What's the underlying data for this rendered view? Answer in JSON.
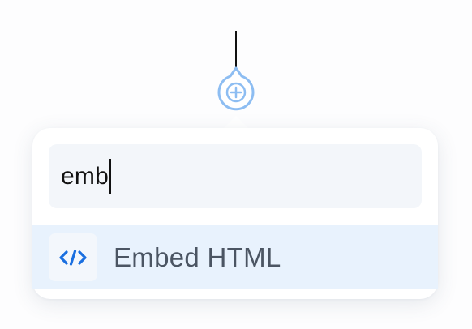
{
  "add_button": {
    "icon": "plus-icon",
    "color": "#8dbdf2"
  },
  "search": {
    "value": "emb"
  },
  "results": [
    {
      "label": "Embed HTML",
      "icon": "code-icon",
      "icon_color": "#1a6fe0",
      "highlighted": true
    }
  ]
}
